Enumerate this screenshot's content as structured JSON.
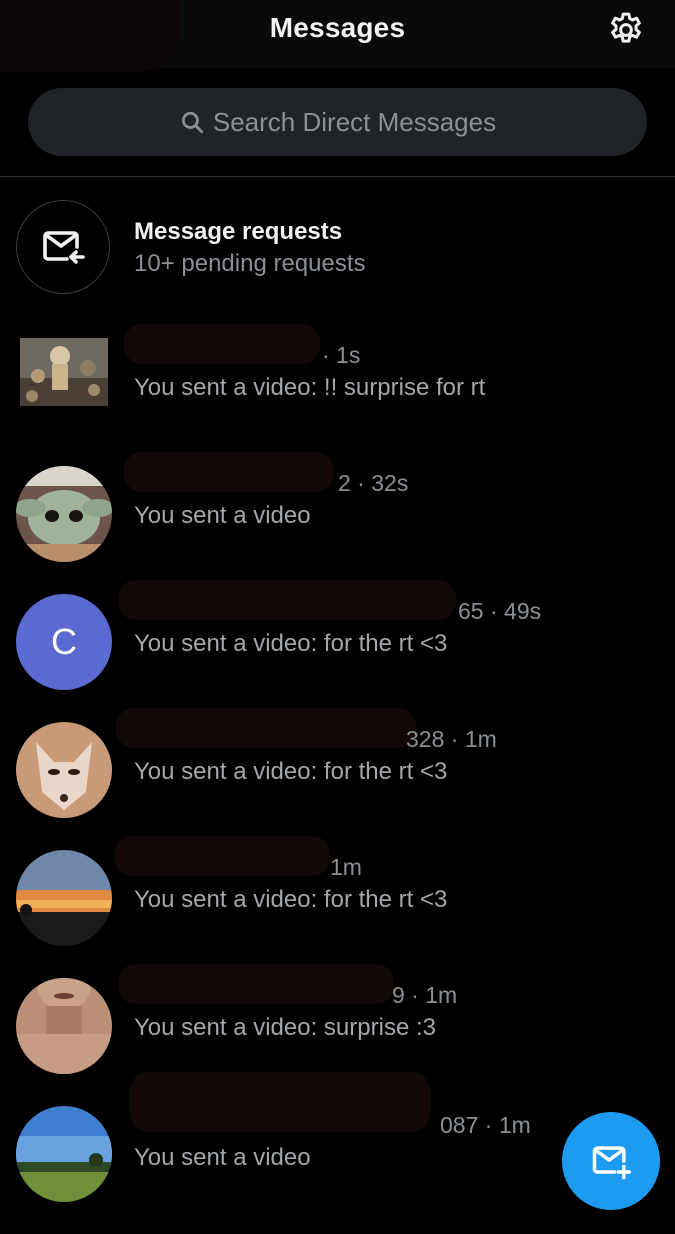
{
  "header": {
    "title": "Messages",
    "settings_icon": "gear-icon"
  },
  "search": {
    "placeholder": "Search Direct Messages",
    "icon": "search-icon"
  },
  "requests": {
    "title": "Message requests",
    "subtitle": "10+ pending requests",
    "icon": "mail-incoming-icon"
  },
  "conversations": [
    {
      "meta": "· 1s",
      "preview": "You sent a video: !! surprise for rt"
    },
    {
      "meta": "2 · 32s",
      "preview": "You sent a video"
    },
    {
      "meta": "65 · 49s",
      "preview": "You sent a video: for the rt <3",
      "avatar_letter": "C"
    },
    {
      "meta": "328 · 1m",
      "preview": "You sent a video: for the rt <3"
    },
    {
      "meta": "1m",
      "preview": "You sent a video: for the rt <3"
    },
    {
      "meta": "9 · 1m",
      "preview": "You sent a video: surprise :3"
    },
    {
      "meta": "087 · 1m",
      "preview": "You sent a video"
    }
  ],
  "fab": {
    "icon": "new-message-icon"
  },
  "colors": {
    "background": "#000000",
    "accent": "#1d9bf0",
    "search_bg": "#202327",
    "secondary_text": "#8b9096",
    "avatar_c": "#5b6ad0"
  }
}
